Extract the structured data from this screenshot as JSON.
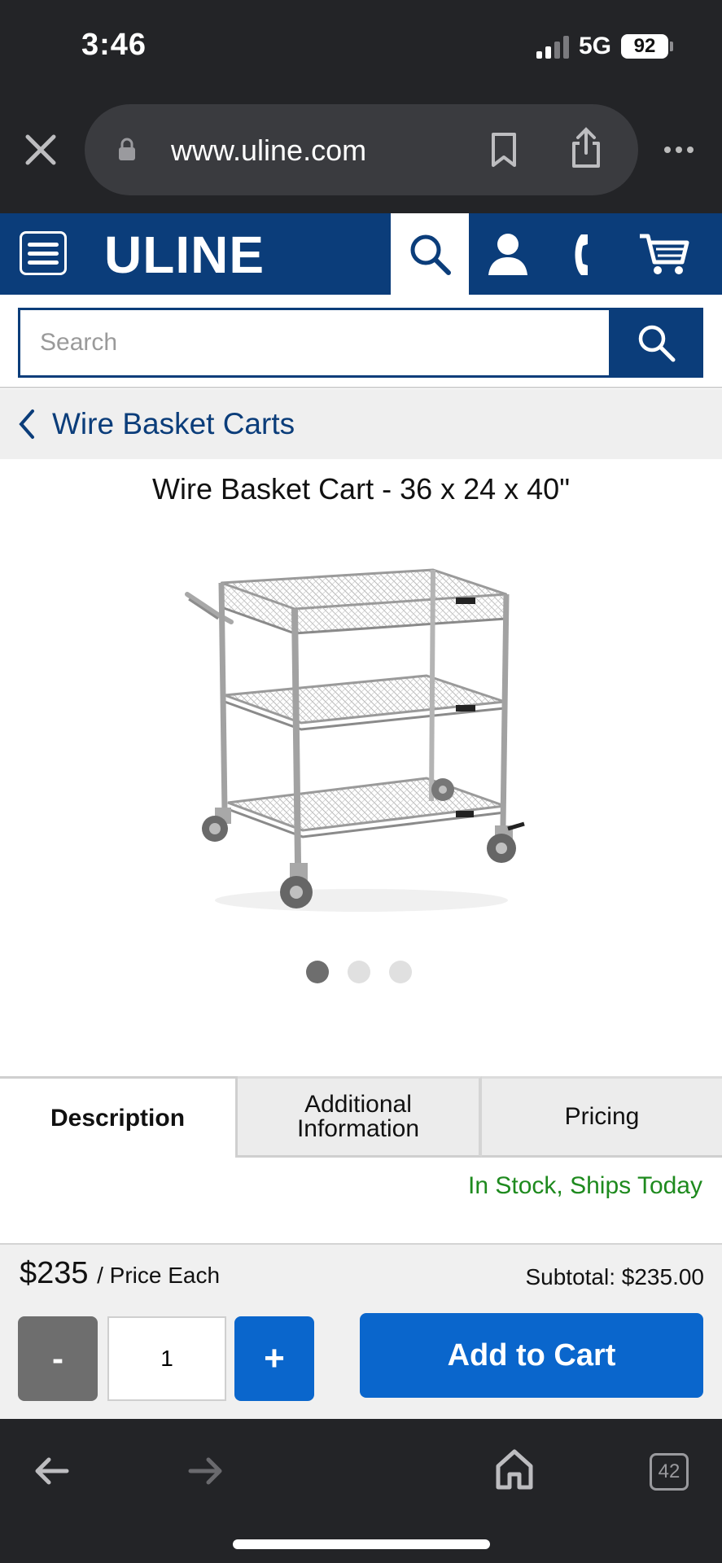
{
  "status_bar": {
    "time": "3:46",
    "network": "5G",
    "battery": "92"
  },
  "browser": {
    "url": "www.uline.com",
    "tab_count": "42"
  },
  "header": {
    "logo": "ULINE"
  },
  "search": {
    "placeholder": "Search"
  },
  "breadcrumb": {
    "label": "Wire Basket Carts"
  },
  "product": {
    "title": "Wire Basket Cart - 36 x 24 x 40\"",
    "image_icon": "wire-basket-cart-image",
    "carousel": {
      "count": 3,
      "active_index": 0
    }
  },
  "tabs": [
    {
      "label": "Description",
      "active": true
    },
    {
      "label": "Additional Information",
      "active": false
    },
    {
      "label": "Pricing",
      "active": false
    }
  ],
  "stock_status": "In Stock, Ships Today",
  "pricing": {
    "price": "$235",
    "unit": "/ Price Each",
    "subtotal": "Subtotal: $235.00",
    "quantity": "1",
    "minus_label": "-",
    "plus_label": "+",
    "add_to_cart_label": "Add to Cart"
  },
  "colors": {
    "brand_blue": "#0b3d7a",
    "action_blue": "#0a66cc",
    "stock_green": "#1e8a1e"
  }
}
